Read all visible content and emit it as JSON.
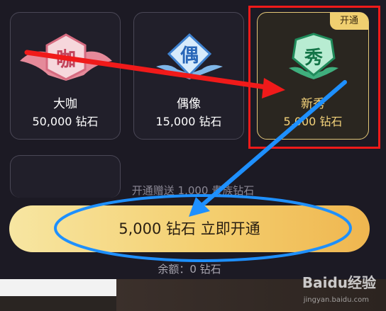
{
  "tiers": [
    {
      "name": "大咖",
      "price": "50,000 钻石",
      "glyph": "咖",
      "icon": "pink-crest-badge-icon"
    },
    {
      "name": "偶像",
      "price": "15,000 钻石",
      "glyph": "偶",
      "icon": "blue-crest-badge-icon"
    },
    {
      "name": "新秀",
      "price": "5,000 钻石",
      "glyph": "秀",
      "icon": "green-crest-badge-icon",
      "selected": true,
      "tag": "开通"
    }
  ],
  "gift_text": "开通赠送 1,000 贵族钻石",
  "buy_button": "5,000 钻石 立即开通",
  "balance": "余额：0 钻石",
  "watermark": {
    "logo": "Baidu经验",
    "url": "jingyan.baidu.com"
  },
  "colors": {
    "accent": "#f3d27a",
    "annotation_red": "#f01a1a",
    "annotation_blue": "#1e90ff"
  }
}
